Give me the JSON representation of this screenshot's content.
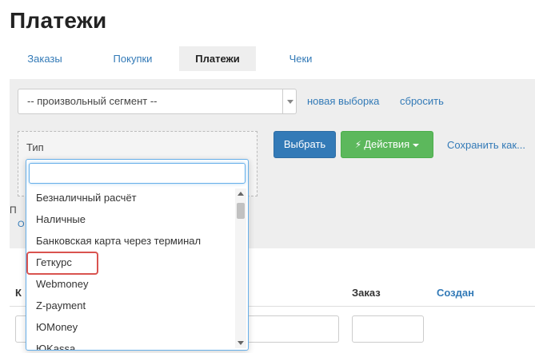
{
  "page_title": "Платежи",
  "tabs": [
    {
      "label": "Заказы",
      "active": false
    },
    {
      "label": "Покупки",
      "active": false
    },
    {
      "label": "Платежи",
      "active": true
    },
    {
      "label": "Чеки",
      "active": false
    }
  ],
  "filter": {
    "segment_value": "-- произвольный сегмент --",
    "new_sample_link": "новая выборка",
    "reset_link": "сбросить",
    "type_label": "Тип",
    "select_button": "Выбрать",
    "actions_button": "Действия",
    "actions_icon": "bolt-icon",
    "save_link": "Сохранить как...",
    "peek_p": "П",
    "peek_o": "О"
  },
  "dropdown": {
    "search_value": "",
    "options": [
      "Безналичный расчёт",
      "Наличные",
      "Банковская карта через терминал",
      "Геткурс",
      "Webmoney",
      "Z-payment",
      "ЮMoney",
      "ЮKassa"
    ],
    "highlighted_option": "Геткурс",
    "highlight_color": "#d9534f"
  },
  "table": {
    "headers": {
      "first_partial": "К",
      "order": "Заказ",
      "created": "Создан"
    }
  },
  "colors": {
    "primary": "#337ab7",
    "success": "#5cb85c",
    "panel_bg": "#eeeeee"
  }
}
